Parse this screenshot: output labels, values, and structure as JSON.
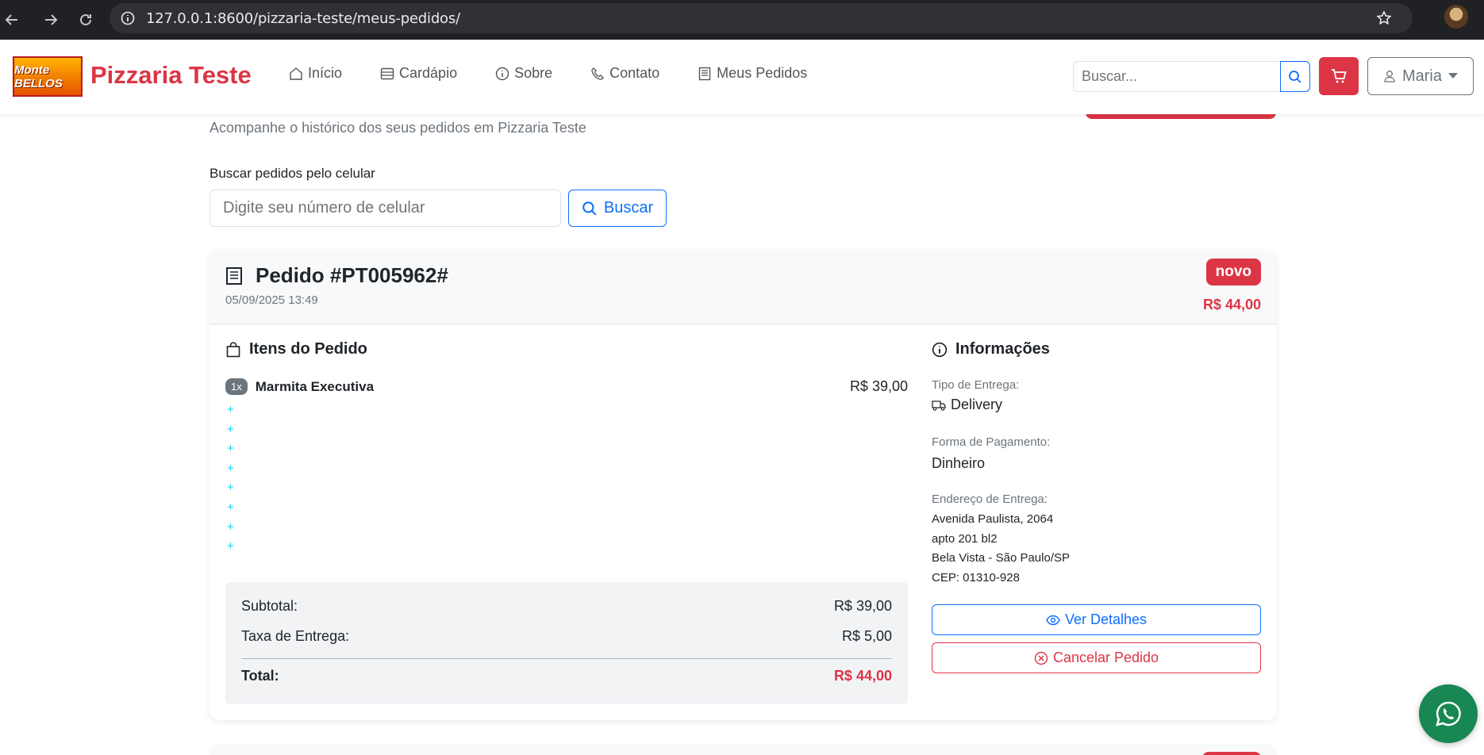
{
  "browser": {
    "url": "127.0.0.1:8600/pizzaria-teste/meus-pedidos/"
  },
  "navbar": {
    "logo_text": "Monte BELLOS",
    "brand": "Pizzaria Teste",
    "links": [
      {
        "label": "Início",
        "icon": "house-icon"
      },
      {
        "label": "Cardápio",
        "icon": "menu-card-icon"
      },
      {
        "label": "Sobre",
        "icon": "info-icon"
      },
      {
        "label": "Contato",
        "icon": "phone-icon"
      },
      {
        "label": "Meus Pedidos",
        "icon": "receipt-icon"
      }
    ],
    "search_placeholder": "Buscar...",
    "user_name": "Maria"
  },
  "page": {
    "subtitle": "Acompanhe o histórico dos seus pedidos em Pizzaria Teste",
    "search_label": "Buscar pedidos pelo celular",
    "phone_placeholder": "Digite seu número de celular",
    "search_button": "Buscar"
  },
  "order": {
    "title": "Pedido #PT005962#",
    "date": "05/09/2025 13:49",
    "status": "novo",
    "header_total": "R$ 44,00",
    "items_title": "Itens do Pedido",
    "items": [
      {
        "qty": "1x",
        "name": "Marmita Executiva",
        "price": "R$ 39,00"
      }
    ],
    "addon_markers": [
      "+",
      "+",
      "+",
      "+",
      "+",
      "+",
      "+",
      "+"
    ],
    "subtotal_label": "Subtotal:",
    "subtotal": "R$ 39,00",
    "delivery_fee_label": "Taxa de Entrega:",
    "delivery_fee": "R$ 5,00",
    "total_label": "Total:",
    "total": "R$ 44,00",
    "info_title": "Informações",
    "delivery_type_label": "Tipo de Entrega:",
    "delivery_type": "Delivery",
    "payment_label": "Forma de Pagamento:",
    "payment": "Dinheiro",
    "address_label": "Endereço de Entrega:",
    "address_lines": [
      "Avenida Paulista, 2064",
      "apto 201 bl2",
      "Bela Vista - São Paulo/SP",
      "CEP: 01310-928"
    ],
    "details_button": "Ver Detalhes",
    "cancel_button": "Cancelar Pedido"
  },
  "colors": {
    "brand_red": "#dc3545",
    "primary_blue": "#0d6efd",
    "whatsapp_green": "#198754",
    "addon_cyan": "#0dcaf0"
  }
}
